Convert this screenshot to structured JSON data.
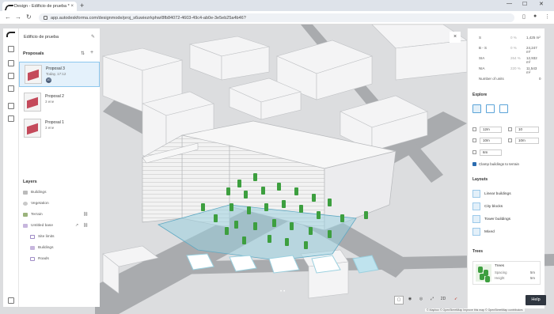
{
  "browser": {
    "tab_title": "Design - Edificio de prueba *",
    "url": "app.autodeskforma.com/designmode/proj_s6uwiezrkphw/8fb84072-4603-49c4-ab0e-3e5eb25a4b46?",
    "new_tab": "+",
    "tab_close": "×"
  },
  "project": {
    "title": "Edificio de prueba"
  },
  "proposals": {
    "heading": "Proposals",
    "items": [
      {
        "name": "Proposal 3",
        "subtitle": "Today, 17:12",
        "avatar": "JG"
      },
      {
        "name": "Proposal 2",
        "subtitle": "3 ene"
      },
      {
        "name": "Proposal 1",
        "subtitle": "3 ene"
      }
    ]
  },
  "layers": {
    "heading": "Layers",
    "items": [
      {
        "label": "Buildings"
      },
      {
        "label": "Vegetation"
      },
      {
        "label": "Terrain"
      },
      {
        "label": "Untitled base"
      },
      {
        "label": "Site limits"
      },
      {
        "label": "Buildings"
      },
      {
        "label": "Roads"
      }
    ]
  },
  "details": {
    "rows": [
      {
        "label": "S",
        "pct": "0 %",
        "value": "1,425 m²"
      },
      {
        "label": "B - S",
        "pct": "0 %",
        "value": "24,247 m²"
      },
      {
        "label": "SIA",
        "pct": "264 %",
        "value": "12,932 m²"
      },
      {
        "label": "NIA",
        "pct": "220 %",
        "value": "11,543 m²"
      }
    ],
    "units_label": "Number of units",
    "units_value": "0"
  },
  "explore": {
    "heading": "Explore",
    "fields": [
      {
        "value": "12m"
      },
      {
        "value": "10"
      },
      {
        "value": "10m"
      },
      {
        "value": "10m"
      },
      {
        "value": "6m"
      }
    ],
    "clamp_label": "Clamp buildings to terrain"
  },
  "layouts": {
    "heading": "Layouts",
    "items": [
      {
        "label": "Linear buildings"
      },
      {
        "label": "City blocks"
      },
      {
        "label": "Tower buildings"
      },
      {
        "label": "Mixed"
      }
    ]
  },
  "trees": {
    "heading": "Trees",
    "card_title": "Trees",
    "spacing_label": "Spacing",
    "spacing_value": "5m",
    "height_label": "Height",
    "height_value": "5m"
  },
  "help_label": "Help",
  "viewport_close": "×",
  "view_mode": "2D",
  "attribution": "© Mapbox © OpenStreetMap Improve this map © OpenStreetMap contributors",
  "colors": {
    "accent": "#2b6cb0",
    "proposal_selected": "#e4f1fb",
    "tree_green": "#3d9f3f",
    "site_highlight": "#9ad0df"
  }
}
